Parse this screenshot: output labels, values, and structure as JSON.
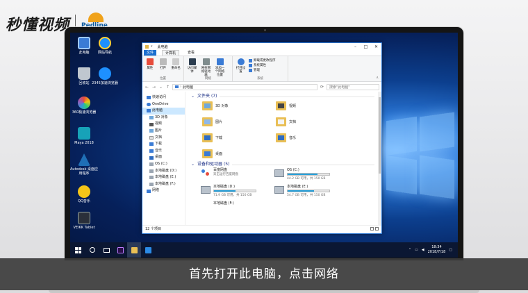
{
  "watermark": {
    "brand": "秒懂视频",
    "logo": "Pedline"
  },
  "subtitle": "首先打开此电脑，点击网络",
  "desktop_icons": [
    {
      "label": "此电脑",
      "icon": "computer-icon"
    },
    {
      "label": "回收站",
      "icon": "recycle-bin-icon"
    },
    {
      "label": "360极速浏览器",
      "icon": "browser-icon"
    },
    {
      "label": "Maya 2018",
      "icon": "maya-icon"
    },
    {
      "label": "Autodesk 桌面应用程序",
      "icon": "autodesk-icon"
    },
    {
      "label": "QQ音乐",
      "icon": "qq-music-icon"
    },
    {
      "label": "VEIKK Tablet",
      "icon": "tablet-icon"
    },
    {
      "label": "网站导航",
      "icon": "ie-icon"
    },
    {
      "label": "2345加速浏览器",
      "icon": "ie-icon"
    }
  ],
  "explorer": {
    "title": "此电脑",
    "tabs": [
      "文件",
      "计算机",
      "查看"
    ],
    "ribbon": {
      "location": {
        "name": "位置",
        "buttons": [
          "属性",
          "打开",
          "重命名"
        ]
      },
      "network": {
        "name": "网络",
        "buttons": [
          "访问媒体",
          "映射网络驱动器",
          "添加一个网络位置"
        ]
      },
      "system": {
        "name": "系统",
        "buttons": [
          "打开设置"
        ],
        "items": [
          "卸载或更改程序",
          "系统属性",
          "管理"
        ]
      }
    },
    "address": {
      "path": "此电脑",
      "search_placeholder": "搜索\"此电脑\""
    },
    "nav_items": [
      {
        "label": "快速访问",
        "sub": false
      },
      {
        "label": "OneDrive",
        "sub": false
      },
      {
        "label": "此电脑",
        "sub": false
      },
      {
        "label": "3D 对象",
        "sub": true
      },
      {
        "label": "视频",
        "sub": true
      },
      {
        "label": "图片",
        "sub": true
      },
      {
        "label": "文档",
        "sub": true
      },
      {
        "label": "下载",
        "sub": true
      },
      {
        "label": "音乐",
        "sub": true
      },
      {
        "label": "桌面",
        "sub": true
      },
      {
        "label": "OS (C:)",
        "sub": true
      },
      {
        "label": "本地磁盘 (D:)",
        "sub": true
      },
      {
        "label": "本地磁盘 (E:)",
        "sub": true
      },
      {
        "label": "本地磁盘 (F:)",
        "sub": true
      },
      {
        "label": "网络",
        "sub": false
      }
    ],
    "folders_header": "文件夹 (7)",
    "folders": [
      "3D 对象",
      "视频",
      "图片",
      "文档",
      "下载",
      "音乐",
      "桌面"
    ],
    "devices_header": "设备和驱动器 (5)",
    "drives": [
      {
        "name": "百度网盘",
        "desc": "双击运行百度网盘",
        "used": null
      },
      {
        "name": "OS (C:)",
        "desc": "44.2 GB 可用，共 150 GB",
        "used": 0.71
      },
      {
        "name": "本地磁盘 (D:)",
        "desc": "71.9 GB 可用，共 150 GB",
        "used": 0.52
      },
      {
        "name": "本地磁盘 (E:)",
        "desc": "54.7 GB 可用，共 150 GB",
        "used": 0.64
      },
      {
        "name": "本地磁盘 (F:)",
        "desc": "",
        "used": null
      }
    ],
    "status": "12 个项目"
  },
  "taskbar": {
    "time": "18:34",
    "date": "2018/7/18"
  },
  "colors": {
    "accent": "#1c6fcf",
    "taskbar": "#0b1733",
    "folder": "#e9bf55"
  }
}
